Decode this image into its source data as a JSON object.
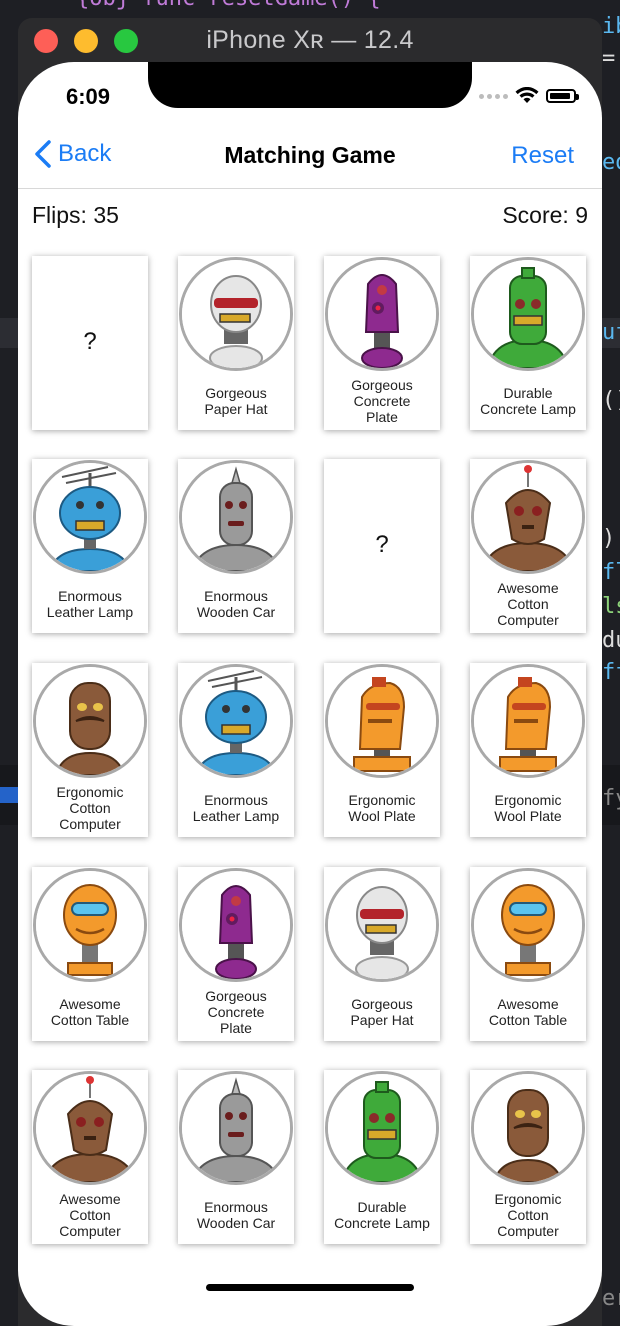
{
  "window_title": "iPhone Xʀ — 12.4",
  "status": {
    "time": "6:09"
  },
  "nav": {
    "back_label": "Back",
    "title": "Matching Game",
    "reset_label": "Reset"
  },
  "stats": {
    "flips": "Flips: 35",
    "score": "Score: 9"
  },
  "cards": [
    {
      "face": "down",
      "label": "",
      "symbol": "?"
    },
    {
      "face": "up",
      "label": "Gorgeous Paper Hat",
      "robot": "white-robot"
    },
    {
      "face": "up",
      "label": "Gorgeous Concrete Plate",
      "robot": "purple-robot"
    },
    {
      "face": "up",
      "label": "Durable Concrete Lamp",
      "robot": "green-robot"
    },
    {
      "face": "up",
      "label": "Enormous Leather Lamp",
      "robot": "blue-antenna-robot"
    },
    {
      "face": "up",
      "label": "Enormous Wooden Car",
      "robot": "gray-spike-robot"
    },
    {
      "face": "down",
      "label": "",
      "symbol": "?"
    },
    {
      "face": "up",
      "label": "Awesome Cotton Computer",
      "robot": "brown-antenna-robot"
    },
    {
      "face": "up",
      "label": "Ergonomic Cotton Computer",
      "robot": "brown-mustache-robot"
    },
    {
      "face": "up",
      "label": "Enormous Leather Lamp",
      "robot": "blue-antenna-robot"
    },
    {
      "face": "up",
      "label": "Ergonomic Wool Plate",
      "robot": "orange-robot"
    },
    {
      "face": "up",
      "label": "Ergonomic Wool Plate",
      "robot": "orange-robot"
    },
    {
      "face": "up",
      "label": "Awesome Cotton Table",
      "robot": "orange-visor-robot"
    },
    {
      "face": "up",
      "label": "Gorgeous Concrete Plate",
      "robot": "purple-robot"
    },
    {
      "face": "up",
      "label": "Gorgeous Paper Hat",
      "robot": "white-robot"
    },
    {
      "face": "up",
      "label": "Awesome Cotton Table",
      "robot": "orange-visor-robot"
    },
    {
      "face": "up",
      "label": "Awesome Cotton Computer",
      "robot": "brown-antenna-robot"
    },
    {
      "face": "up",
      "label": "Enormous Wooden Car",
      "robot": "gray-spike-robot"
    },
    {
      "face": "up",
      "label": "Durable Concrete Lamp",
      "robot": "green-robot"
    },
    {
      "face": "up",
      "label": "Ergonomic Cotton Computer",
      "robot": "brown-mustache-robot"
    }
  ],
  "colors": {
    "accent": "#1b7cf5",
    "robot_white": "#e6e6e6",
    "robot_purple": "#8e2a8f",
    "robot_green": "#3faa3a",
    "robot_blue": "#3a9fd8",
    "robot_gray": "#9a9a9a",
    "robot_brown": "#8a5a3a",
    "robot_orange": "#f39a2c"
  },
  "background_code": [
    "{obj  func  resetGame() {",
    "ib",
    "=",
    "ed",
    "uf",
    "()",
    ")",
    "fl",
    "ls",
    "du",
    "ff",
    "fy",
    "er"
  ]
}
